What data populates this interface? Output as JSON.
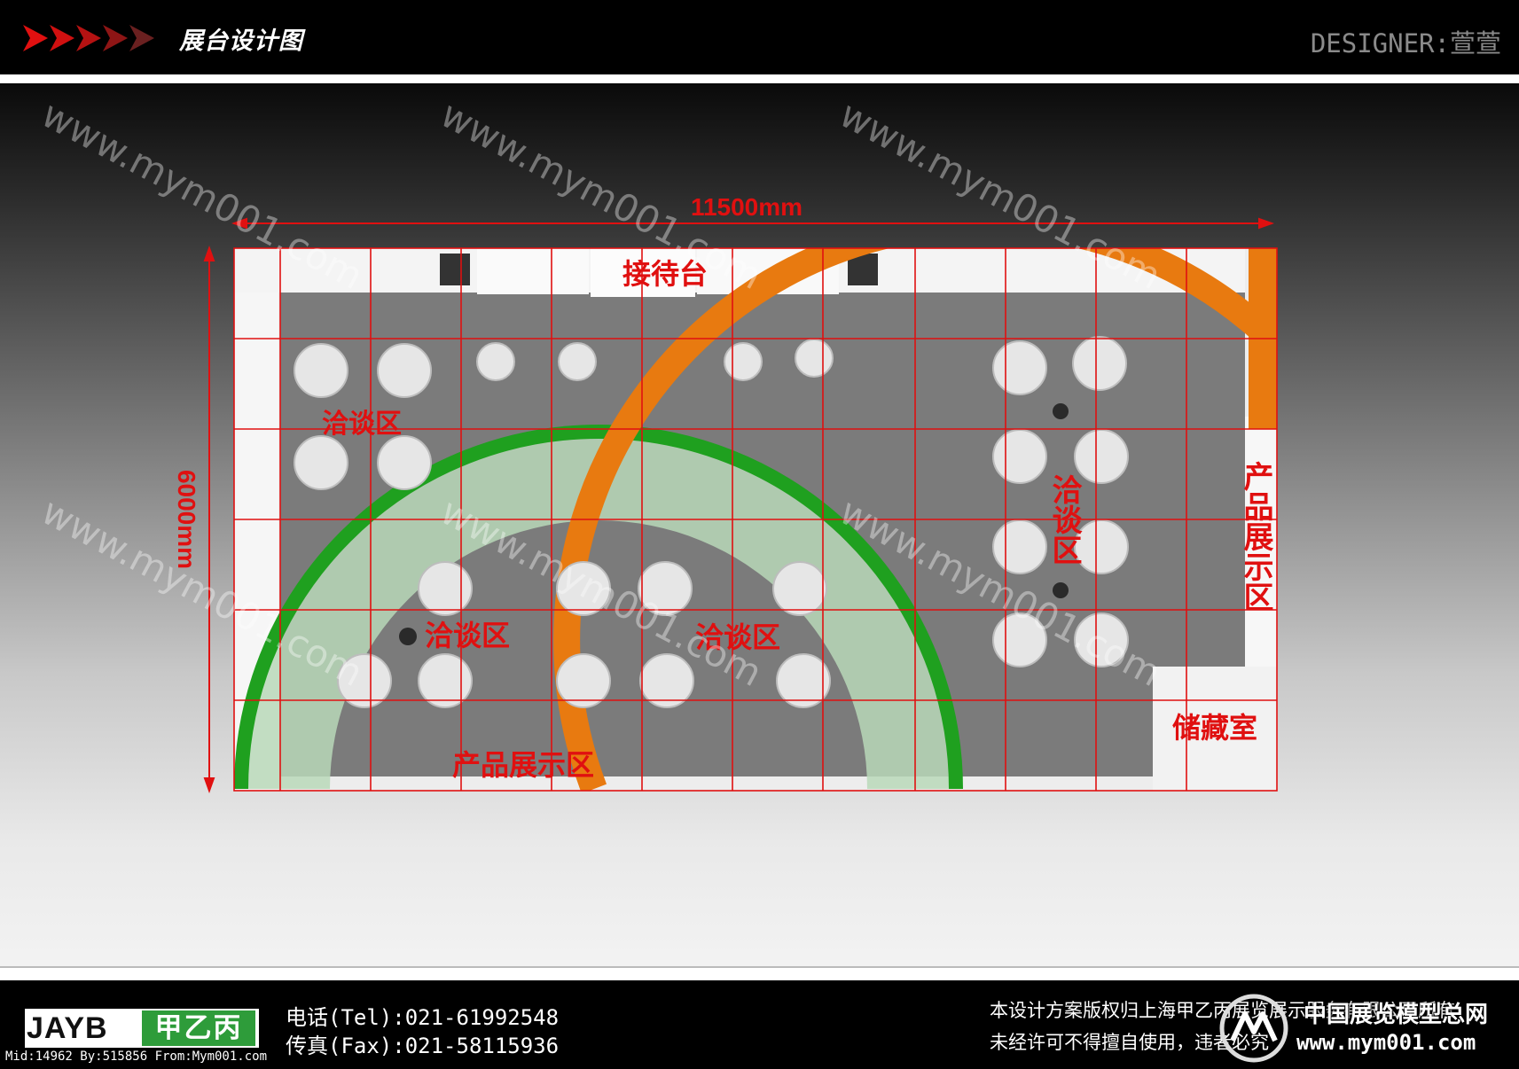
{
  "header": {
    "title": "展台设计图",
    "designer_label": "DESIGNER:",
    "designer_name": "萱萱"
  },
  "dimensions": {
    "width_label": "11500mm",
    "height_label": "6000mm"
  },
  "zones": {
    "reception": "接待台",
    "negotiation_top_left": "洽谈区",
    "negotiation_center_left": "洽谈区",
    "negotiation_center_right": "洽谈区",
    "negotiation_right": "洽谈区",
    "product_display_bottom": "产品展示区",
    "product_display_right": "产品展示区",
    "storage": "储藏室"
  },
  "watermark_text": "www.mym001.com",
  "footer": {
    "logo_en": "JAYB",
    "logo_cn": "甲乙丙",
    "mid_line": "Mid:14962 By:515856 From:Mym001.com",
    "tel": "电话(Tel):021-61992548",
    "fax": "传真(Fax):021-58115936",
    "copyright_line1": "本设计方案版权归上海甲乙丙展览展示服务有限公司所有",
    "copyright_line2": "未经许可不得擅自使用，违者必究",
    "net_name": "中国展览模型总网",
    "net_url": "www.mym001.com"
  },
  "colors": {
    "grid": "#e01010",
    "label": "#e01010",
    "green_arc": "#1fa01f",
    "orange_arc": "#e87a10",
    "carpet": "#7d7d7d"
  }
}
